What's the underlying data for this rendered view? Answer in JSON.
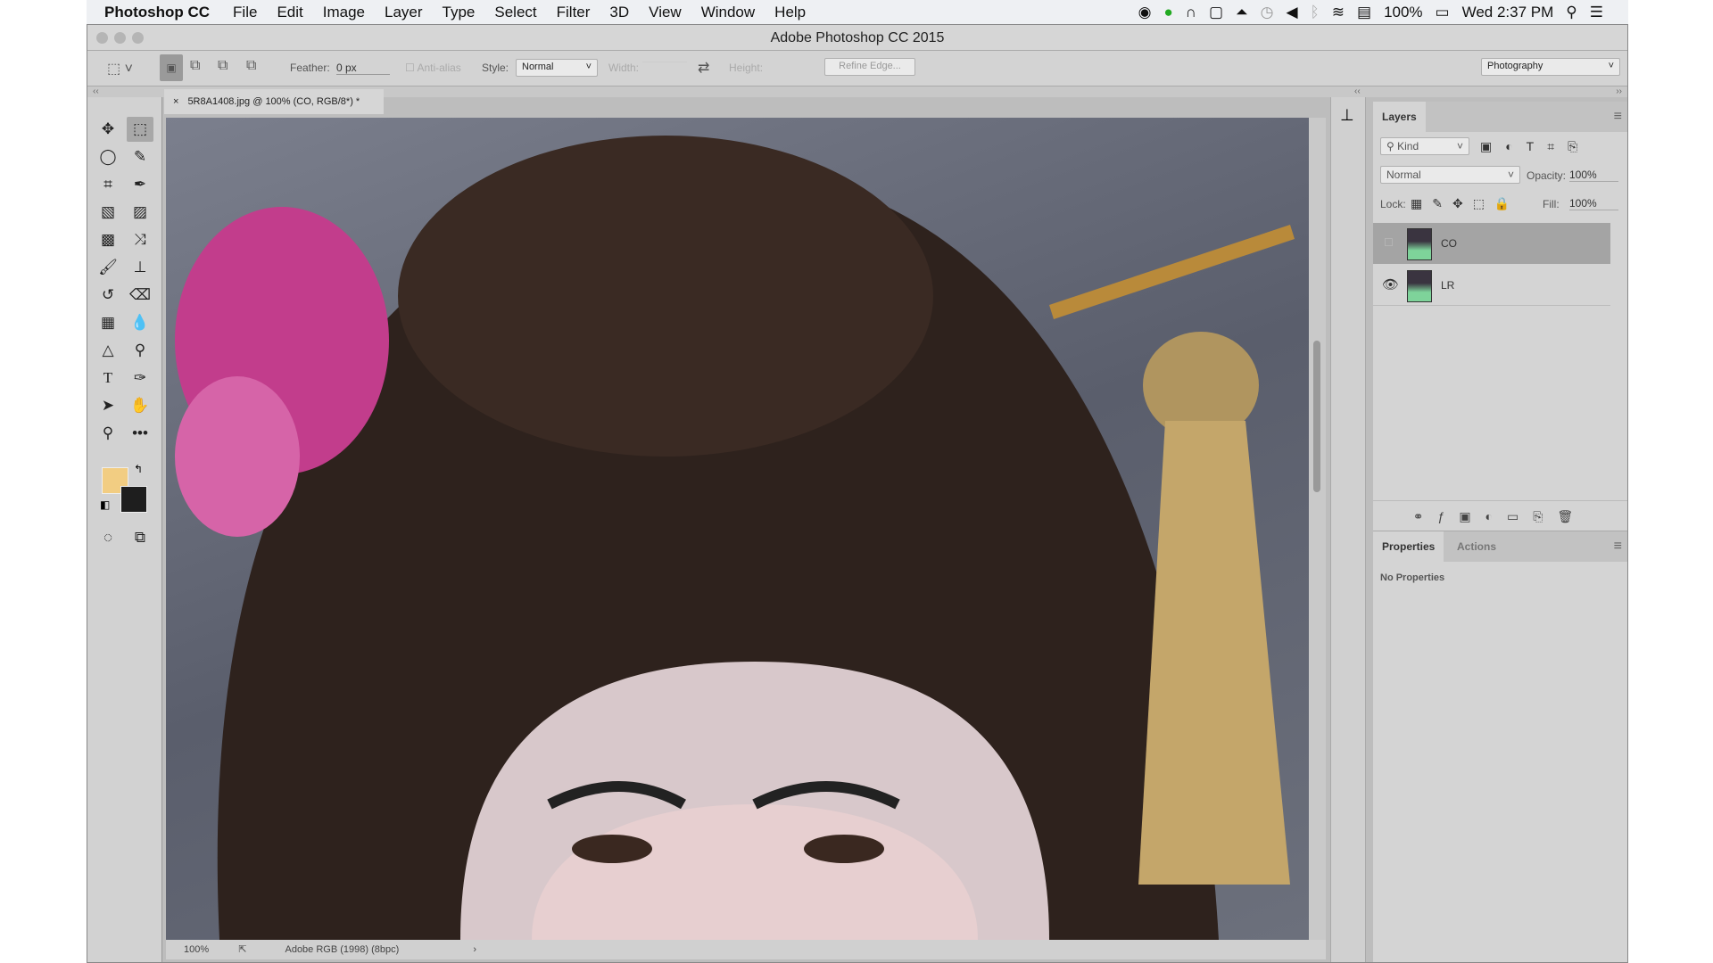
{
  "menubar": {
    "app": "Photoshop CC",
    "items": [
      "File",
      "Edit",
      "Image",
      "Layer",
      "Type",
      "Select",
      "Filter",
      "3D",
      "View",
      "Window",
      "Help"
    ],
    "battery": "100%",
    "clock": "Wed 2:37 PM"
  },
  "window": {
    "title": "Adobe Photoshop CC 2015"
  },
  "options": {
    "feather_label": "Feather:",
    "feather_value": "0 px",
    "antialias": "Anti-alias",
    "style_label": "Style:",
    "style_value": "Normal",
    "width_label": "Width:",
    "height_label": "Height:",
    "refine": "Refine Edge...",
    "workspace": "Photography"
  },
  "document": {
    "tab": "5R8A1408.jpg @ 100% (CO, RGB/8*) *",
    "zoom": "100%",
    "profile": "Adobe RGB (1998) (8bpc)"
  },
  "colors": {
    "foreground": "#f2cd82",
    "background": "#1e1e1e"
  },
  "layers": {
    "title": "Layers",
    "filter": "Kind",
    "blend": "Normal",
    "opacity_label": "Opacity:",
    "opacity": "100%",
    "lock_label": "Lock:",
    "fill_label": "Fill:",
    "fill": "100%",
    "items": [
      {
        "name": "CO",
        "visible": false,
        "selected": true
      },
      {
        "name": "LR",
        "visible": true,
        "selected": false
      }
    ]
  },
  "properties": {
    "tabs": [
      "Properties",
      "Actions"
    ],
    "empty": "No Properties"
  }
}
